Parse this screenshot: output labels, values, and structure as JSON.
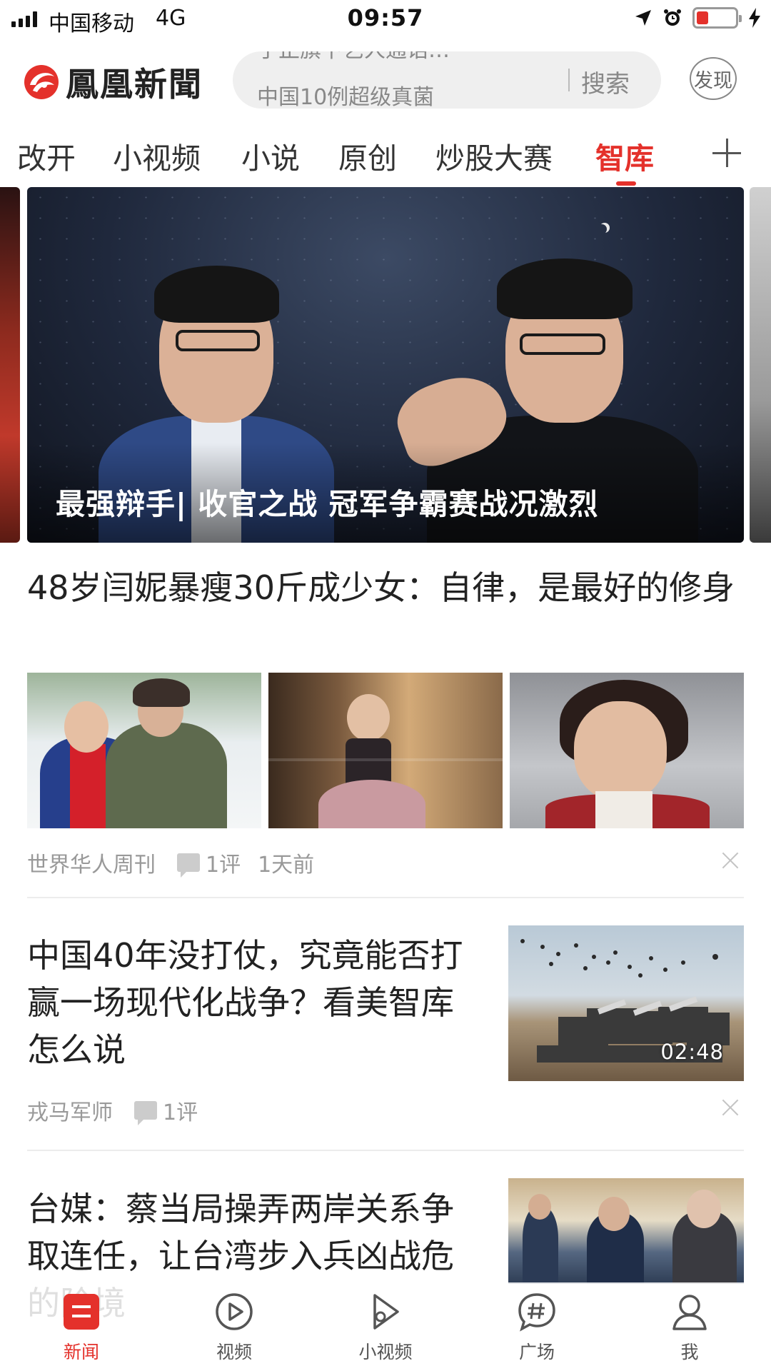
{
  "status_bar": {
    "carrier": "中国移动",
    "network": "4G",
    "time": "09:57",
    "battery_level": 0.3
  },
  "header": {
    "logo_text": "鳳凰新聞",
    "search_ticker": [
      "于正旗下艺人通话…",
      "中国10例超级真菌"
    ],
    "search_label": "搜索",
    "discover_label": "发现"
  },
  "tabs": {
    "items": [
      {
        "label": "改开"
      },
      {
        "label": "小视频"
      },
      {
        "label": "小说"
      },
      {
        "label": "原创"
      },
      {
        "label": "炒股大赛"
      },
      {
        "label": "智库",
        "active": true
      }
    ],
    "active_color": "#e4312b"
  },
  "carousel": {
    "caption": "最强辩手| 收官之战 冠军争霸赛战况激烈"
  },
  "articles": [
    {
      "title": "48岁闫妮暴瘦30斤成少女：自律，是最好的修身",
      "source": "世界华人周刊",
      "comments": "1评",
      "time": "1天前"
    },
    {
      "title": "中国40年没打仗，究竟能否打赢一场现代化战争？看美智库怎么说",
      "source": "戎马军师",
      "comments": "1评",
      "duration": "02:48"
    },
    {
      "title": "台媒：蔡当局操弄两岸关系争取连任，让台湾步入兵凶战危的险境"
    }
  ],
  "bottom_nav": {
    "items": [
      {
        "label": "新闻",
        "icon": "news-icon",
        "active": true
      },
      {
        "label": "视频",
        "icon": "video-play-icon"
      },
      {
        "label": "小视频",
        "icon": "short-video-icon"
      },
      {
        "label": "广场",
        "icon": "square-hash-icon"
      },
      {
        "label": "我",
        "icon": "profile-icon"
      }
    ]
  },
  "colors": {
    "accent": "#e4312b",
    "meta_text": "#999999"
  }
}
